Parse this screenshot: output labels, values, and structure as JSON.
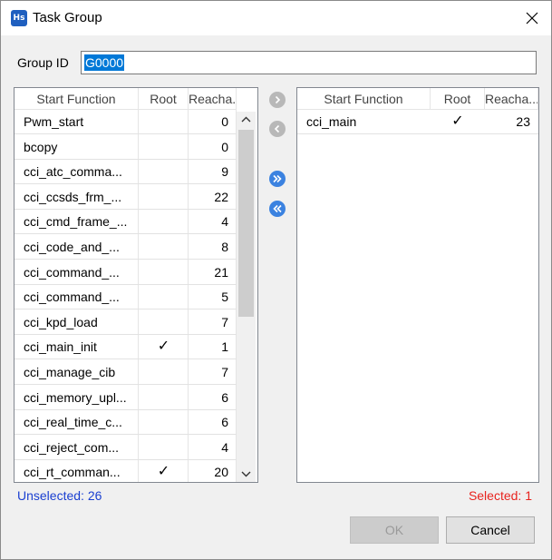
{
  "window": {
    "icon_text": "Hs",
    "title": "Task Group"
  },
  "group_id": {
    "label": "Group ID",
    "value": "G0000"
  },
  "columns": {
    "start_function": "Start Function",
    "root": "Root",
    "reachable": "Reacha..."
  },
  "unselected_list": [
    {
      "name": "Pwm_start",
      "root": "",
      "reach": "0"
    },
    {
      "name": "bcopy",
      "root": "",
      "reach": "0"
    },
    {
      "name": "cci_atc_comma...",
      "root": "",
      "reach": "9"
    },
    {
      "name": "cci_ccsds_frm_...",
      "root": "",
      "reach": "22"
    },
    {
      "name": "cci_cmd_frame_...",
      "root": "",
      "reach": "4"
    },
    {
      "name": "cci_code_and_...",
      "root": "",
      "reach": "8"
    },
    {
      "name": "cci_command_...",
      "root": "",
      "reach": "21"
    },
    {
      "name": "cci_command_...",
      "root": "",
      "reach": "5"
    },
    {
      "name": "cci_kpd_load",
      "root": "",
      "reach": "7"
    },
    {
      "name": "cci_main_init",
      "root": "✓",
      "reach": "1"
    },
    {
      "name": "cci_manage_cib",
      "root": "",
      "reach": "7"
    },
    {
      "name": "cci_memory_upl...",
      "root": "",
      "reach": "6"
    },
    {
      "name": "cci_real_time_c...",
      "root": "",
      "reach": "6"
    },
    {
      "name": "cci_reject_com...",
      "root": "",
      "reach": "4"
    },
    {
      "name": "cci_rt_comman...",
      "root": "✓",
      "reach": "20"
    }
  ],
  "selected_list": [
    {
      "name": "cci_main",
      "root": "✓",
      "reach": "23"
    }
  ],
  "counts": {
    "unselected": "Unselected: 26",
    "selected": "Selected: 1"
  },
  "buttons": {
    "ok": "OK",
    "cancel": "Cancel"
  },
  "icons": {
    "move_right": "chevron-right-icon",
    "move_left": "chevron-left-icon",
    "move_all_right": "double-chevron-right-icon",
    "move_all_left": "double-chevron-left-icon"
  },
  "colors": {
    "accent": "#3b82e0",
    "disabled_button": "#b8b8b8",
    "unselected_text": "#1a3fd1",
    "selected_text": "#e8231e",
    "selection": "#0078d7"
  }
}
